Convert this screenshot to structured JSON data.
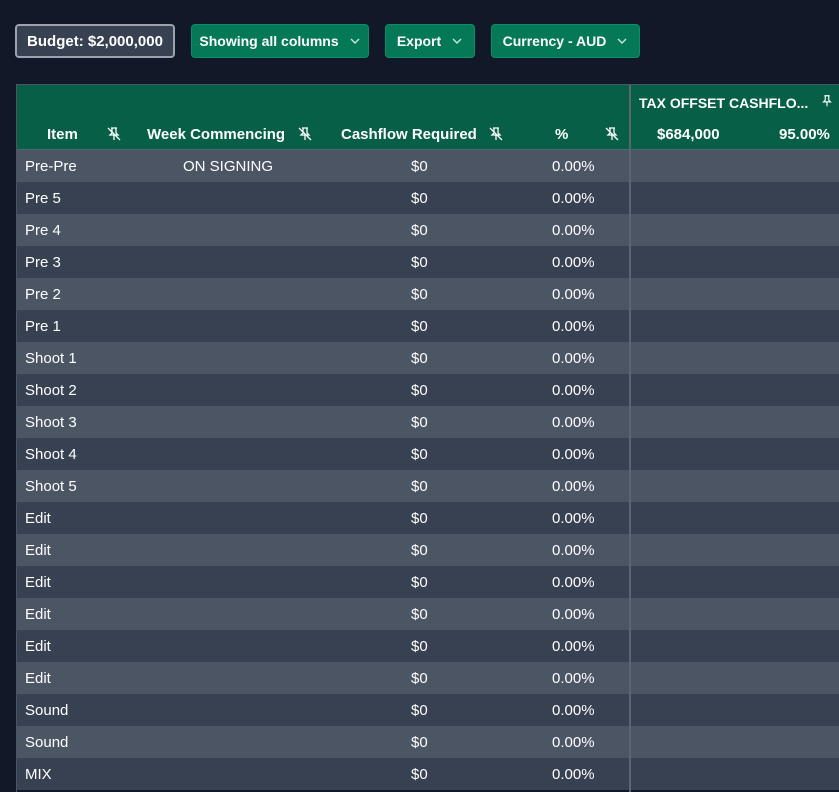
{
  "toolbar": {
    "budget_label": "Budget: $2,000,000",
    "columns_label": "Showing all columns",
    "export_label": "Export",
    "currency_label": "Currency - AUD"
  },
  "colors": {
    "background": "#111827",
    "header_green": "#065f46",
    "button_green": "#047857",
    "row_light": "#4b5563",
    "row_dark": "#374151"
  },
  "table": {
    "columns": {
      "item": "Item",
      "week": "Week Commencing",
      "cashflow": "Cashflow Required",
      "percent": "%"
    },
    "tax_offset": {
      "title": "TAX OFFSET CASHFLO...",
      "amount": "$684,000",
      "percent": "95.00%"
    },
    "rows": [
      {
        "item": "Pre-Pre",
        "week": "ON SIGNING",
        "cashflow": "$0",
        "percent": "0.00%"
      },
      {
        "item": "Pre 5",
        "week": "",
        "cashflow": "$0",
        "percent": "0.00%"
      },
      {
        "item": "Pre 4",
        "week": "",
        "cashflow": "$0",
        "percent": "0.00%"
      },
      {
        "item": "Pre 3",
        "week": "",
        "cashflow": "$0",
        "percent": "0.00%"
      },
      {
        "item": "Pre 2",
        "week": "",
        "cashflow": "$0",
        "percent": "0.00%"
      },
      {
        "item": "Pre 1",
        "week": "",
        "cashflow": "$0",
        "percent": "0.00%"
      },
      {
        "item": "Shoot 1",
        "week": "",
        "cashflow": "$0",
        "percent": "0.00%"
      },
      {
        "item": "Shoot 2",
        "week": "",
        "cashflow": "$0",
        "percent": "0.00%"
      },
      {
        "item": "Shoot 3",
        "week": "",
        "cashflow": "$0",
        "percent": "0.00%"
      },
      {
        "item": "Shoot 4",
        "week": "",
        "cashflow": "$0",
        "percent": "0.00%"
      },
      {
        "item": "Shoot 5",
        "week": "",
        "cashflow": "$0",
        "percent": "0.00%"
      },
      {
        "item": "Edit",
        "week": "",
        "cashflow": "$0",
        "percent": "0.00%"
      },
      {
        "item": "Edit",
        "week": "",
        "cashflow": "$0",
        "percent": "0.00%"
      },
      {
        "item": "Edit",
        "week": "",
        "cashflow": "$0",
        "percent": "0.00%"
      },
      {
        "item": "Edit",
        "week": "",
        "cashflow": "$0",
        "percent": "0.00%"
      },
      {
        "item": "Edit",
        "week": "",
        "cashflow": "$0",
        "percent": "0.00%"
      },
      {
        "item": "Edit",
        "week": "",
        "cashflow": "$0",
        "percent": "0.00%"
      },
      {
        "item": "Sound",
        "week": "",
        "cashflow": "$0",
        "percent": "0.00%"
      },
      {
        "item": "Sound",
        "week": "",
        "cashflow": "$0",
        "percent": "0.00%"
      },
      {
        "item": "MIX",
        "week": "",
        "cashflow": "$0",
        "percent": "0.00%"
      }
    ]
  }
}
